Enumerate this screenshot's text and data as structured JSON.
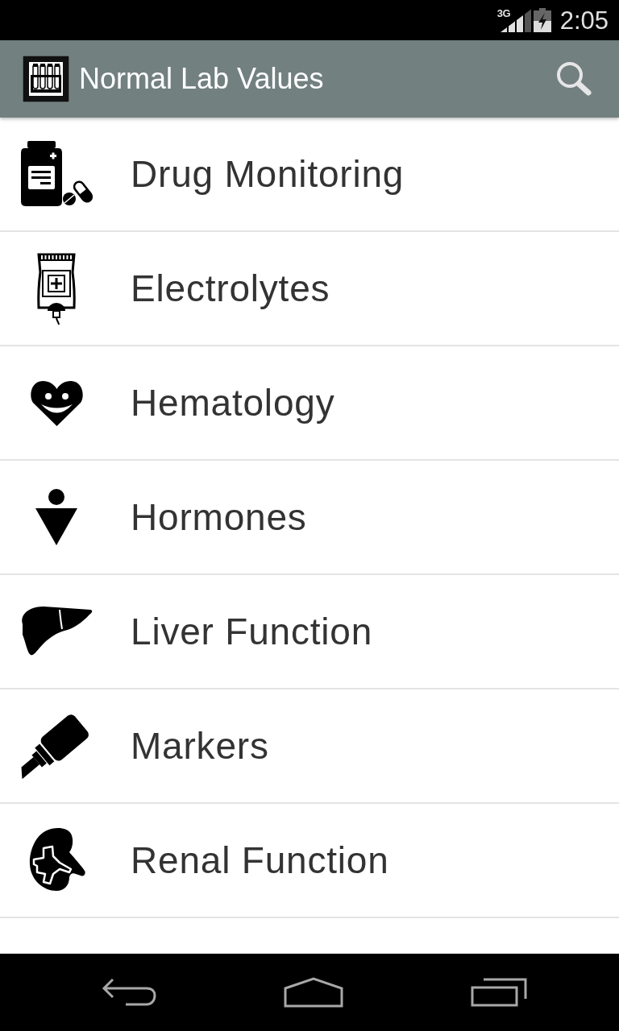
{
  "status_bar": {
    "network": "3G",
    "time": "2:05"
  },
  "app_bar": {
    "title": "Normal Lab Values"
  },
  "categories": [
    {
      "label": "Drug Monitoring",
      "kind": "bottle"
    },
    {
      "label": "Electrolytes",
      "kind": "iv-bag"
    },
    {
      "label": "Hematology",
      "kind": "heart"
    },
    {
      "label": "Hormones",
      "kind": "figure"
    },
    {
      "label": "Liver Function",
      "kind": "liver"
    },
    {
      "label": "Markers",
      "kind": "marker"
    },
    {
      "label": "Renal Function",
      "kind": "kidney"
    }
  ]
}
